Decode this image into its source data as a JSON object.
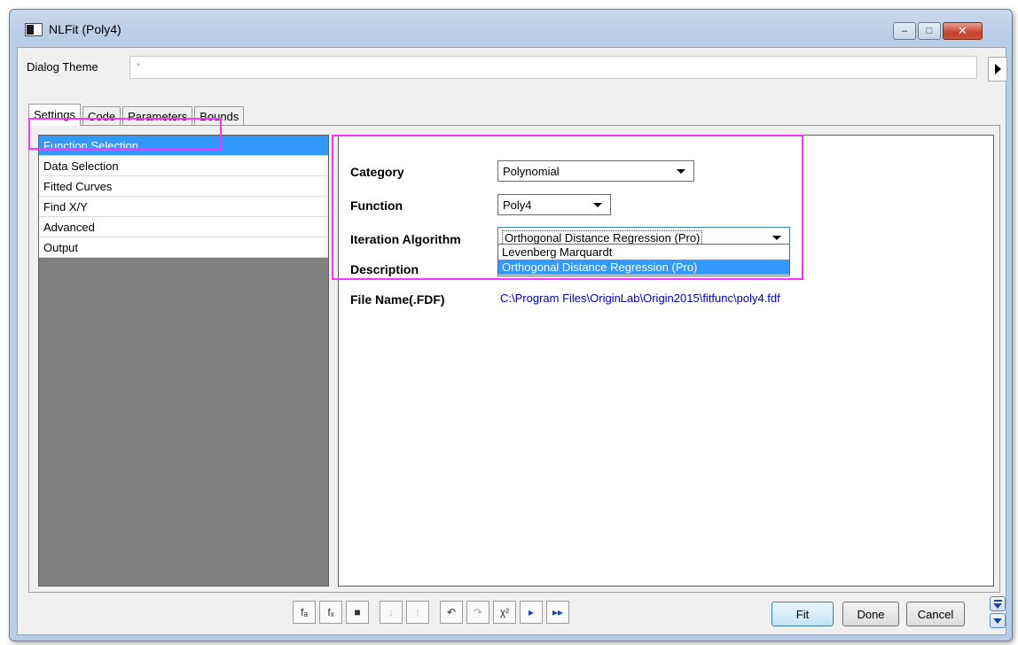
{
  "window": {
    "title": "NLFit (Poly4)",
    "min_glyph": "–",
    "max_glyph": "□",
    "close_glyph": "✕"
  },
  "theme": {
    "label": "Dialog Theme",
    "value": "*"
  },
  "tabs": [
    {
      "label": "Settings",
      "active": true
    },
    {
      "label": "Code"
    },
    {
      "label": "Parameters"
    },
    {
      "label": "Bounds"
    }
  ],
  "sidebar": {
    "items": [
      {
        "label": "Function Selection",
        "selected": true
      },
      {
        "label": "Data Selection"
      },
      {
        "label": "Fitted Curves"
      },
      {
        "label": "Find X/Y"
      },
      {
        "label": "Advanced"
      },
      {
        "label": "Output"
      }
    ]
  },
  "form": {
    "category_label": "Category",
    "category_value": "Polynomial",
    "function_label": "Function",
    "function_value": "Poly4",
    "iteration_label": "Iteration Algorithm",
    "iteration_value": "Orthogonal Distance Regression (Pro)",
    "iteration_options": [
      "Levenberg Marquardt",
      "Orthogonal Distance Regression (Pro)"
    ],
    "description_label": "Description",
    "filename_label": "File Name(.FDF)",
    "filename_value": "C:\\Program Files\\OriginLab\\Origin2015\\fitfunc\\poly4.fdf"
  },
  "toolbar": {
    "icons": [
      "fx-edit-icon",
      "fx-function-icon",
      "save-icon",
      "sort-down-icon",
      "sort-up-icon",
      "undo-icon",
      "redo-icon",
      "chi-square-icon",
      "fit-one-iteration-icon",
      "fit-until-converged-icon"
    ],
    "glyphs": [
      "fₐ",
      "fₓ",
      "■",
      "↓",
      "↑",
      "↶",
      "↷",
      "χ²",
      "▸",
      "▸▸"
    ]
  },
  "buttons": {
    "fit": "Fit",
    "done": "Done",
    "cancel": "Cancel"
  },
  "colors": {
    "selection": "#3399ff",
    "highlight": "#ff33ff",
    "filename": "#0000cc"
  }
}
